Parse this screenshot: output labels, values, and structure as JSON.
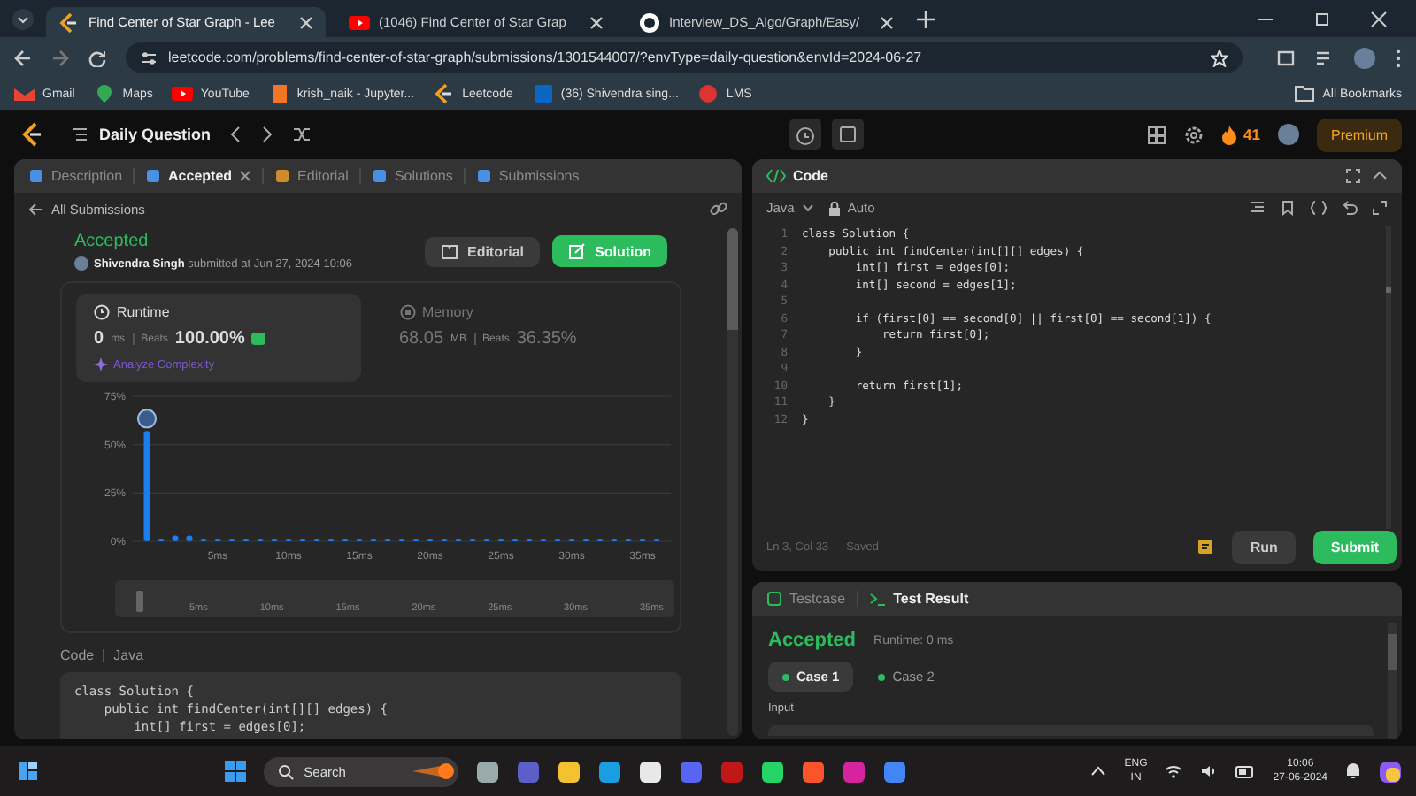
{
  "browser": {
    "tabs": [
      {
        "title": "Find Center of Star Graph - Lee",
        "selected": true
      },
      {
        "title": "(1046) Find Center of Star Grap",
        "selected": false
      },
      {
        "title": "Interview_DS_Algo/Graph/Easy/",
        "selected": false
      }
    ],
    "url": "leetcode.com/problems/find-center-of-star-graph/submissions/1301544007/?envType=daily-question&envId=2024-06-27",
    "bookmarks": [
      "Gmail",
      "Maps",
      "YouTube",
      "krish_naik - Jupyter...",
      "Leetcode",
      "(36) Shivendra sing...",
      "LMS"
    ],
    "bookmarks_folder": "All Bookmarks"
  },
  "topbar": {
    "title": "Daily Question",
    "streak": "41",
    "premium": "Premium"
  },
  "left_panel": {
    "tabs": [
      {
        "label": "Description",
        "selected": false
      },
      {
        "label": "Accepted",
        "selected": true
      },
      {
        "label": "Editorial",
        "selected": false
      },
      {
        "label": "Solutions",
        "selected": false
      },
      {
        "label": "Submissions",
        "selected": false
      }
    ],
    "back_link": "All Submissions",
    "status": "Accepted",
    "author": "Shivendra Singh",
    "submitted": "submitted at Jun 27, 2024 10:06",
    "editorial_button": "Editorial",
    "solution_button": "Solution",
    "stats": [
      {
        "label": "Runtime",
        "value": "0",
        "unit": "ms",
        "beats_label": "Beats",
        "beats": "100.00%",
        "selected": true
      },
      {
        "label": "Memory",
        "value": "68.05",
        "unit": "MB",
        "beats_label": "Beats",
        "beats": "36.35%",
        "selected": false
      }
    ],
    "analyze": "Analyze Complexity",
    "chart_data": {
      "type": "bar",
      "x": [
        0,
        1,
        2,
        3,
        4,
        5,
        6,
        7,
        8,
        9,
        10,
        11,
        12,
        13,
        14,
        15,
        16,
        17,
        18,
        19,
        20,
        21,
        22,
        23,
        24,
        25,
        26,
        27,
        28,
        29,
        30,
        31,
        32,
        33,
        34,
        35,
        36
      ],
      "values": [
        57,
        1,
        3,
        3,
        1,
        1,
        1,
        1,
        1,
        1,
        1,
        1,
        1,
        1,
        1,
        1,
        1,
        1,
        1,
        1,
        1,
        1,
        1,
        1,
        1,
        1,
        1,
        1,
        1,
        1,
        1,
        1,
        1,
        1,
        1,
        1,
        1
      ],
      "xlim": [
        -1,
        37
      ],
      "ylim": [
        0,
        75
      ],
      "yticks": [
        {
          "value": 0,
          "label": "0%"
        },
        {
          "value": 25,
          "label": "25%"
        },
        {
          "value": 50,
          "label": "50%"
        },
        {
          "value": 75,
          "label": "75%"
        }
      ],
      "xticks": [
        {
          "value": 5,
          "label": "5ms"
        },
        {
          "value": 10,
          "label": "10ms"
        },
        {
          "value": 15,
          "label": "15ms"
        },
        {
          "value": 20,
          "label": "20ms"
        },
        {
          "value": 25,
          "label": "25ms"
        },
        {
          "value": 30,
          "label": "30ms"
        },
        {
          "value": 35,
          "label": "35ms"
        }
      ]
    },
    "brush_labels": [
      "5ms",
      "10ms",
      "15ms",
      "20ms",
      "25ms",
      "30ms",
      "35ms"
    ],
    "code_label": "Code",
    "code_language": "Java",
    "code_lines": [
      "class Solution {",
      "    public int findCenter(int[][] edges) {",
      "        int[] first = edges[0];"
    ]
  },
  "editor": {
    "title": "Code",
    "language": "Java",
    "mode": "Auto",
    "lines": [
      {
        "number": "1",
        "text": "class Solution {"
      },
      {
        "number": "2",
        "text": "    public int findCenter(int[][] edges) {"
      },
      {
        "number": "3",
        "text": "        int[] first = edges[0];"
      },
      {
        "number": "4",
        "text": "        int[] second = edges[1];"
      },
      {
        "number": "5"
      },
      {
        "number": "6",
        "text": "        if (first[0] == second[0] || first[0] == second[1]) {"
      },
      {
        "number": "7",
        "text": "            return first[0];"
      },
      {
        "number": "8",
        "text": "        }"
      },
      {
        "number": "9"
      },
      {
        "number": "10",
        "text": "        return first[1];"
      },
      {
        "number": "11",
        "text": "    }"
      },
      {
        "number": "12",
        "text": "}"
      }
    ],
    "cursor": "Ln 3, Col 33",
    "saved": "Saved",
    "run": "Run",
    "submit": "Submit"
  },
  "result": {
    "tabs": [
      {
        "label": "Testcase",
        "selected": false
      },
      {
        "label": "Test Result",
        "selected": true
      }
    ],
    "status": "Accepted",
    "runtime": "Runtime: 0 ms",
    "cases": [
      {
        "label": "Case 1",
        "selected": true
      },
      {
        "label": "Case 2",
        "selected": false
      }
    ],
    "input_label": "Input"
  },
  "taskbar": {
    "search": "Search",
    "language": "ENG",
    "region": "IN",
    "time": "10:06",
    "date": "27-06-2024"
  }
}
